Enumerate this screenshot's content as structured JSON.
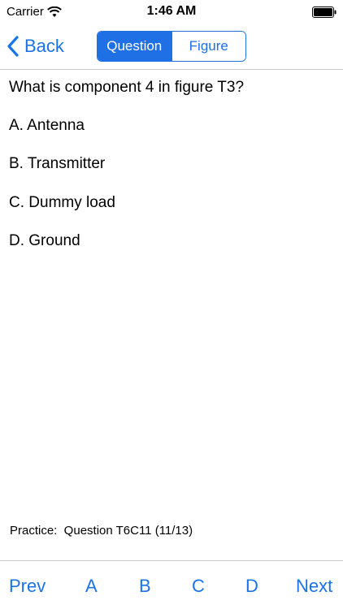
{
  "status_bar": {
    "carrier": "Carrier",
    "time": "1:46 AM"
  },
  "nav": {
    "back_label": "Back",
    "segments": [
      {
        "label": "Question",
        "selected": true
      },
      {
        "label": "Figure",
        "selected": false
      }
    ]
  },
  "question": {
    "text": "What is component 4 in figure T3?",
    "answers": [
      "A.  Antenna",
      "B.  Transmitter",
      "C.  Dummy load",
      "D.  Ground"
    ]
  },
  "footer": {
    "practice": "Practice:  Question T6C11 (11/13)"
  },
  "toolbar": {
    "prev": "Prev",
    "a": "A",
    "b": "B",
    "c": "C",
    "d": "D",
    "next": "Next"
  },
  "colors": {
    "accent": "#1a73e8",
    "segment_blue": "#1f6fe5",
    "separator": "#c8c7cc"
  },
  "icons": [
    "wifi-icon",
    "battery-icon",
    "chevron-left-icon"
  ]
}
